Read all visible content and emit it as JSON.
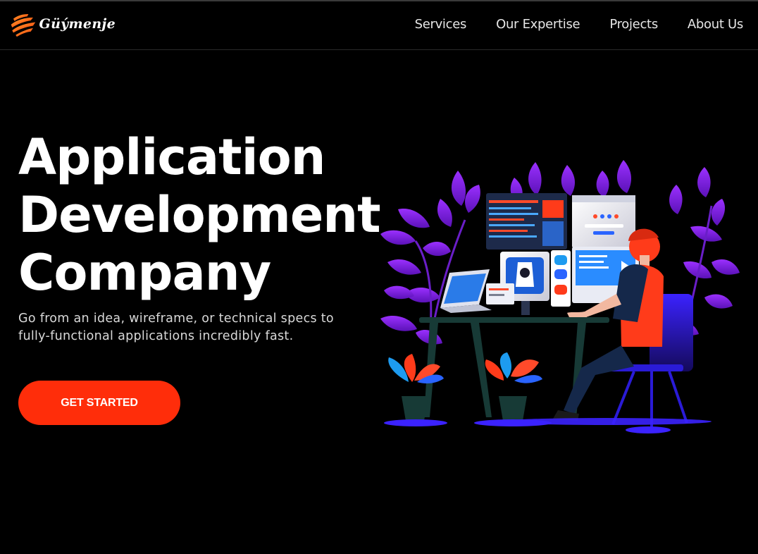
{
  "brand": {
    "name": "Güýmenje",
    "logo_icon": "paint-stroke-logo"
  },
  "nav": {
    "items": [
      {
        "label": "Services"
      },
      {
        "label": "Our Expertise"
      },
      {
        "label": "Projects"
      },
      {
        "label": "About Us"
      }
    ]
  },
  "hero": {
    "title_lines": [
      "Application",
      "Development",
      "Company"
    ],
    "subtitle_line1": "Go from an idea, wireframe, or technical specs to",
    "subtitle_line2": "fully-functional applications incredibly fast.",
    "cta_label": "GET STARTED",
    "illustration": "developer-at-desk-illustration"
  },
  "colors": {
    "background": "#000000",
    "accent": "#ff2d0a",
    "leaf_purple": "#8a2be2",
    "chair_blue": "#2a1bd6"
  }
}
